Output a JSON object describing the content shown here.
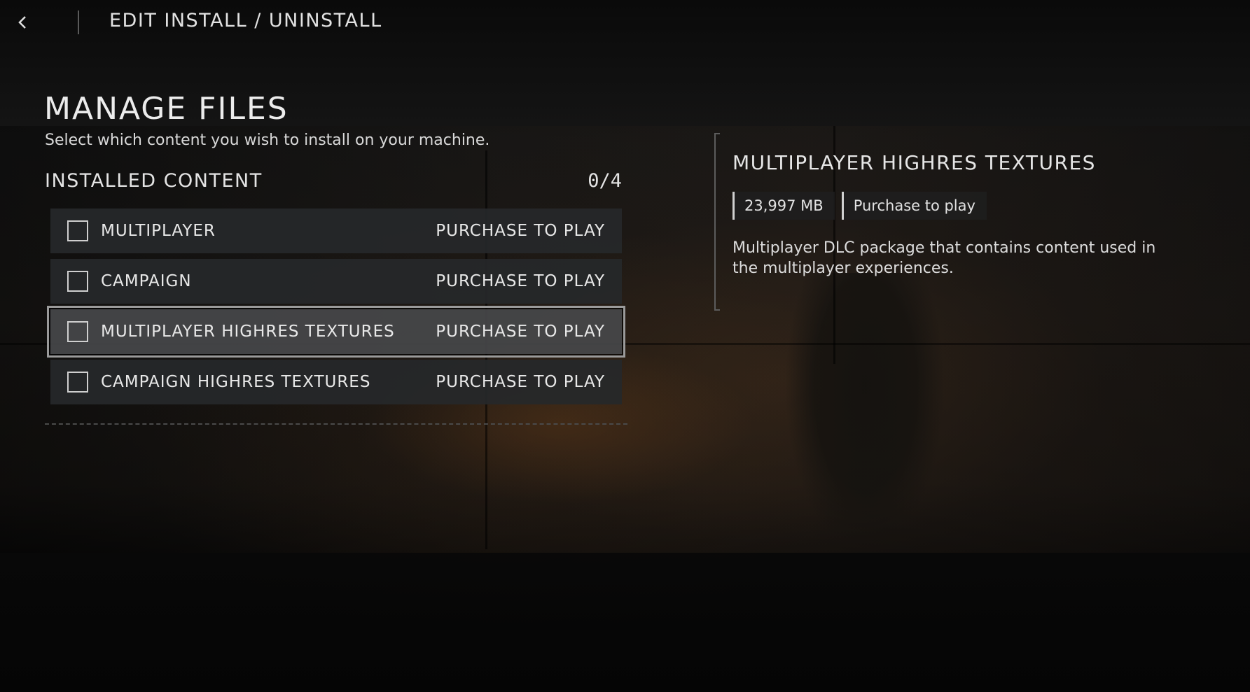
{
  "header": {
    "back_icon": "chevron-left-icon",
    "title": "EDIT INSTALL / UNINSTALL"
  },
  "manage": {
    "title": "MANAGE FILES",
    "subtitle": "Select which content you wish to install on your machine.",
    "section_heading": "INSTALLED CONTENT",
    "count": "0/4",
    "items": [
      {
        "label": "MULTIPLAYER",
        "status": "PURCHASE TO PLAY",
        "checked": false,
        "selected": false
      },
      {
        "label": "CAMPAIGN",
        "status": "PURCHASE TO PLAY",
        "checked": false,
        "selected": false
      },
      {
        "label": "MULTIPLAYER HIGHRES TEXTURES",
        "status": "PURCHASE TO PLAY",
        "checked": false,
        "selected": true
      },
      {
        "label": "CAMPAIGN HIGHRES TEXTURES",
        "status": "PURCHASE TO PLAY",
        "checked": false,
        "selected": false
      }
    ]
  },
  "detail": {
    "title": "MULTIPLAYER HIGHRES TEXTURES",
    "size": "23,997 MB",
    "status": "Purchase to play",
    "description": "Multiplayer DLC package that contains content used in the multiplayer experiences."
  }
}
